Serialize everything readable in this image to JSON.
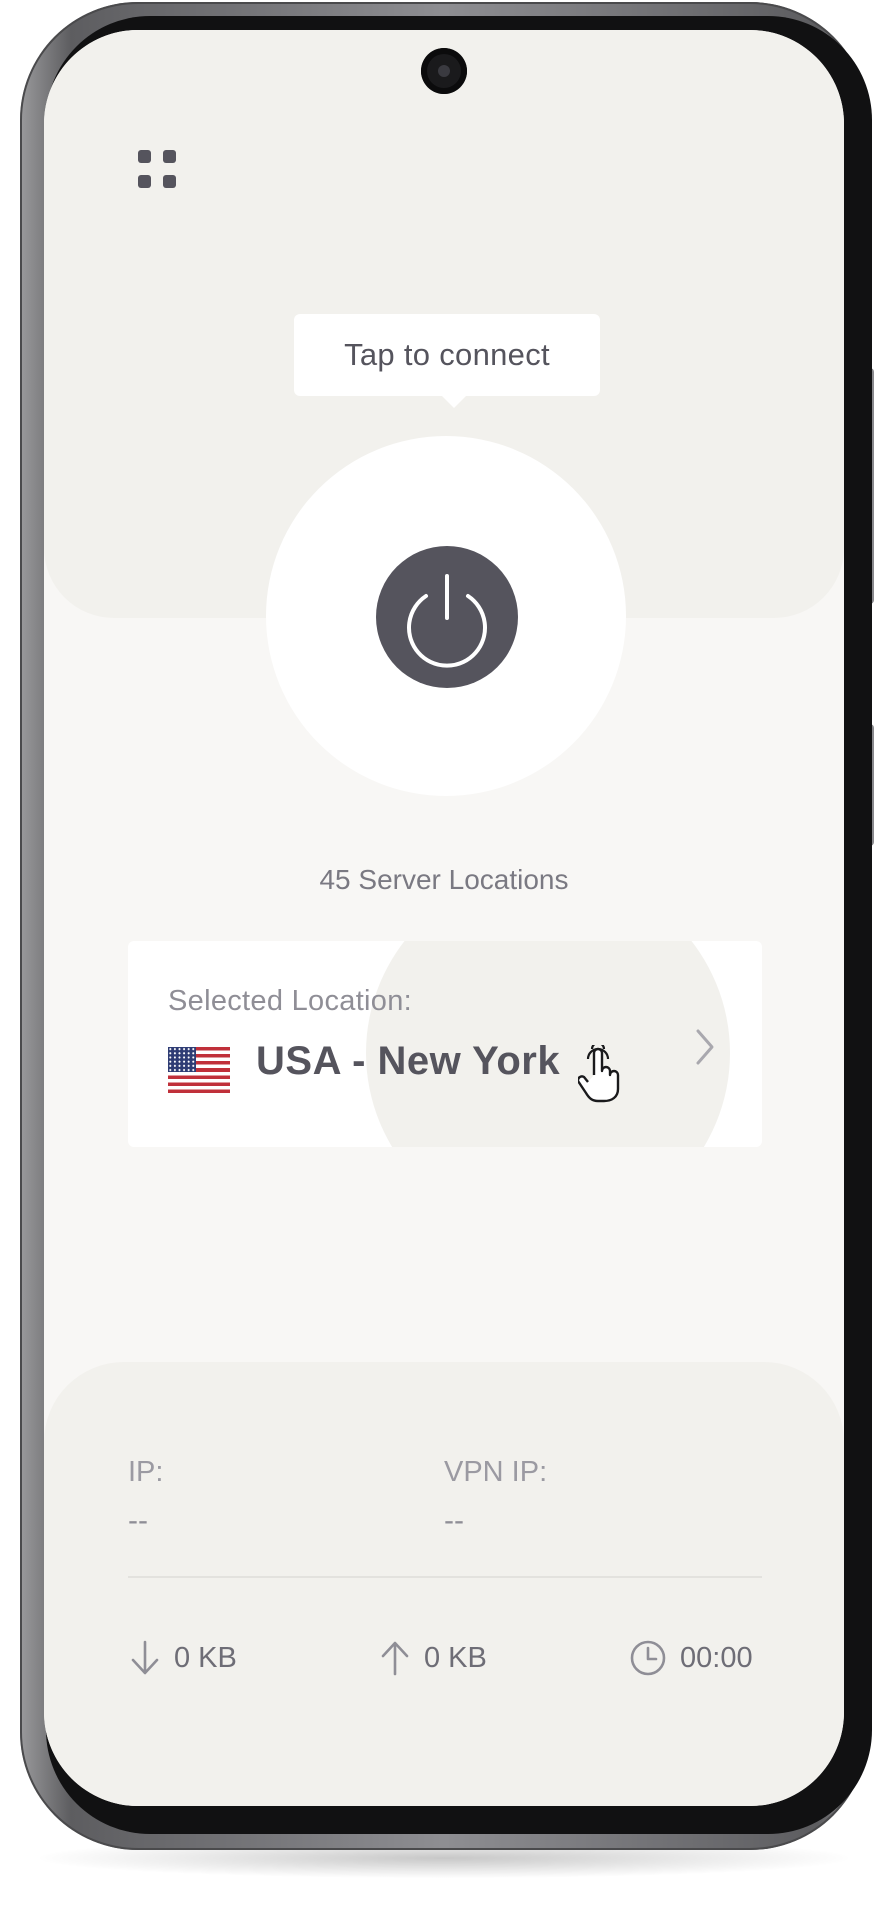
{
  "app": {
    "menu_icon": "grid-menu-icon",
    "tooltip_text": "Tap to connect",
    "power_icon": "power-icon",
    "server_locations": "45 Server Locations"
  },
  "location": {
    "label": "Selected Location:",
    "country_flag": "us-flag-icon",
    "value": "USA - New York",
    "chevron_icon": "chevron-right-icon"
  },
  "connection": {
    "ip_label": "IP:",
    "ip_value": "--",
    "vpn_ip_label": "VPN IP:",
    "vpn_ip_value": "--",
    "download": "0 KB",
    "upload": "0 KB",
    "duration": "00:00"
  },
  "colors": {
    "primary": "#55545d",
    "background": "#f8f7f5",
    "band": "#f2f1ed"
  }
}
